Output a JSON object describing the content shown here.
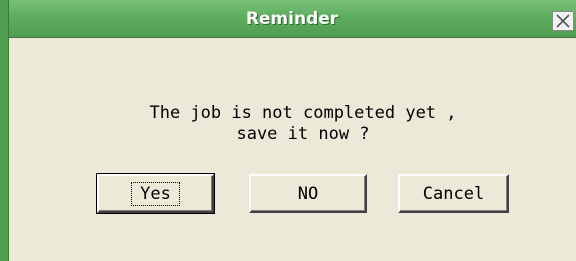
{
  "dialog": {
    "title": "Reminder",
    "message_line1": "The job is not completed yet ,",
    "message_line2": "save it now ?"
  },
  "buttons": {
    "yes_label": "Yes",
    "no_label": "NO",
    "cancel_label": "Cancel"
  },
  "icons": {
    "close": "close-icon"
  },
  "colors": {
    "titlebar": "#5fae5f",
    "dialog_background": "#ece9d8",
    "title_text": "#ffffff"
  }
}
